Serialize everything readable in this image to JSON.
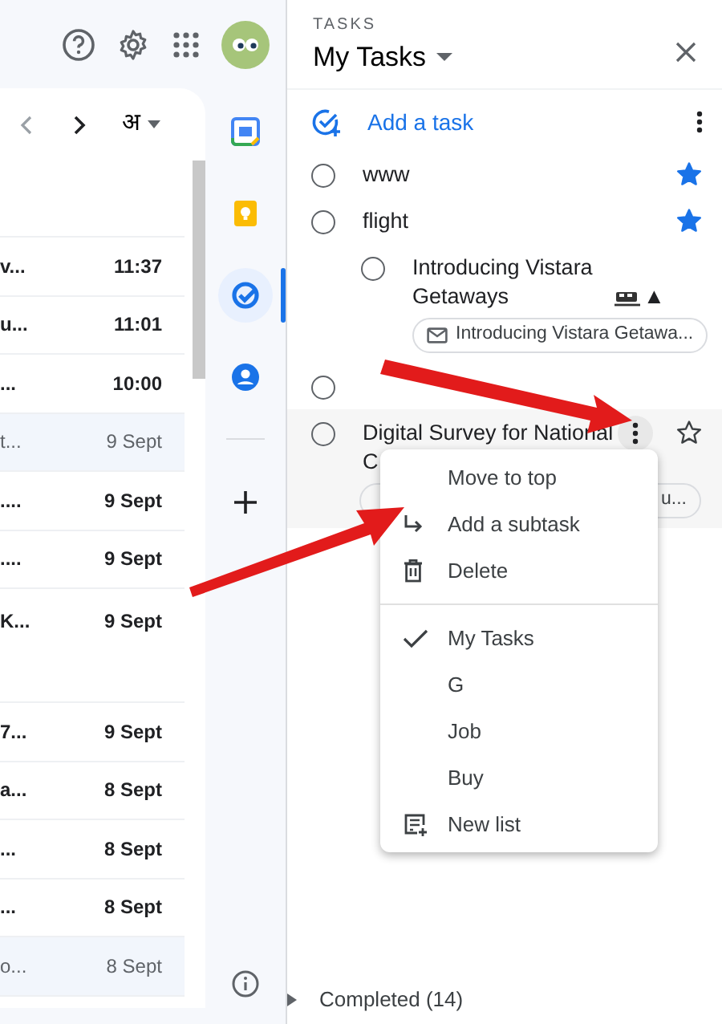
{
  "mail_toolbar": {
    "input_tool": "अ"
  },
  "emails": [
    {
      "snippet": "v...",
      "time": "11:37",
      "unread": true,
      "kind": "standard"
    },
    {
      "snippet": "u...",
      "time": "11:01",
      "unread": true,
      "kind": "standard"
    },
    {
      "snippet": "...",
      "time": "10:00",
      "unread": true,
      "kind": "standard"
    },
    {
      "snippet": "t...",
      "time": "9 Sept",
      "unread": false,
      "kind": "standard"
    },
    {
      "snippet": "....",
      "time": "9 Sept",
      "unread": true,
      "kind": "standard"
    },
    {
      "snippet": "....",
      "time": "9 Sept",
      "unread": true,
      "kind": "standard"
    },
    {
      "snippet": "K...",
      "time": "9 Sept",
      "unread": true,
      "kind": "tall"
    },
    {
      "snippet": "7...",
      "time": "9 Sept",
      "unread": true,
      "kind": "standard"
    },
    {
      "snippet": "a...",
      "time": "8 Sept",
      "unread": true,
      "kind": "standard"
    },
    {
      "snippet": "...",
      "time": "8 Sept",
      "unread": true,
      "kind": "standard"
    },
    {
      "snippet": "...",
      "time": "8 Sept",
      "unread": true,
      "kind": "standard"
    },
    {
      "snippet": "o...",
      "time": "8 Sept",
      "unread": false,
      "kind": "standard"
    }
  ],
  "side_rail": [
    {
      "kind": "calendar",
      "selected": false
    },
    {
      "kind": "keep",
      "selected": false
    },
    {
      "kind": "tasks",
      "selected": true
    },
    {
      "kind": "contacts",
      "selected": false
    },
    {
      "kind": "divider"
    },
    {
      "kind": "add",
      "selected": false
    }
  ],
  "tasks_panel": {
    "label": "TASKS",
    "list_name": "My Tasks",
    "add_label": "Add a task",
    "tasks": [
      {
        "title": "www",
        "starred": true,
        "hovered": false
      },
      {
        "title": "flight",
        "starred": true,
        "hovered": false,
        "children": [
          {
            "title": "Introducing Vistara Getaways",
            "suffix": "▲",
            "chip": "Introducing Vistara Getawa...",
            "starred": false,
            "hovered": false
          }
        ]
      },
      {
        "starred": false,
        "hovered": false
      },
      {
        "title": "Digital Survey for National C",
        "chip": "u...",
        "starred": false,
        "hovered": true
      }
    ],
    "completed": {
      "label": "Completed (14)",
      "expanded": false
    }
  },
  "context_menu": {
    "actions": [
      {
        "label": "Move to top",
        "kind": "plain"
      },
      {
        "label": "Add a subtask",
        "kind": "subtask"
      },
      {
        "label": "Delete",
        "kind": "delete"
      }
    ],
    "lists": [
      {
        "label": "My Tasks",
        "kind": "list",
        "selected": true
      },
      {
        "label": "G",
        "kind": "list",
        "selected": false
      },
      {
        "label": "Job",
        "kind": "list",
        "selected": false
      },
      {
        "label": "Buy",
        "kind": "list",
        "selected": false
      },
      {
        "label": "New list",
        "kind": "new"
      }
    ]
  }
}
